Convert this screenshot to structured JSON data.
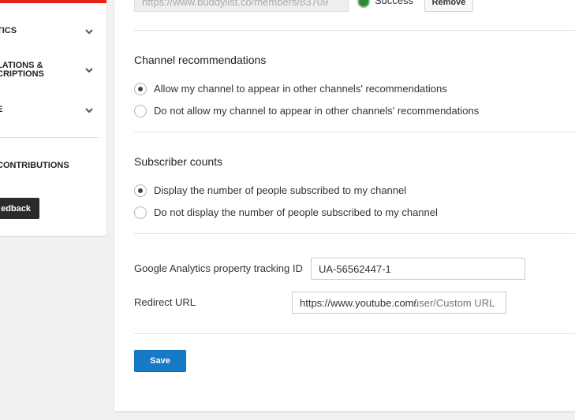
{
  "sidebar": {
    "items": [
      {
        "label": "tics"
      },
      {
        "label": "lations &"
      },
      {
        "label": "criptions"
      },
      {
        "label": "e"
      }
    ],
    "contributions_label": "contributions",
    "feedback_label": "edback"
  },
  "top_row": {
    "url_value": "https://www.buddylist.co/members/83709",
    "status_text": "Success",
    "remove_label": "Remove"
  },
  "channel_recommendations": {
    "title": "Channel recommendations",
    "options": [
      {
        "label": "Allow my channel to appear in other channels' recommendations",
        "checked": true
      },
      {
        "label": "Do not allow my channel to appear in other channels' recommendations",
        "checked": false
      }
    ]
  },
  "subscriber_counts": {
    "title": "Subscriber counts",
    "options": [
      {
        "label": "Display the number of people subscribed to my channel",
        "checked": true
      },
      {
        "label": "Do not display the number of people subscribed to my channel",
        "checked": false
      }
    ]
  },
  "analytics": {
    "label": "Google Analytics property tracking ID",
    "value": "UA-56562447-1"
  },
  "redirect": {
    "label": "Redirect URL",
    "prefix": "https://www.youtube.com/",
    "placeholder": "user/Custom URL"
  },
  "save_label": "Save",
  "colors": {
    "brand_red": "#e62117",
    "primary_blue": "#167ac6",
    "success_green": "#2f8a35"
  }
}
